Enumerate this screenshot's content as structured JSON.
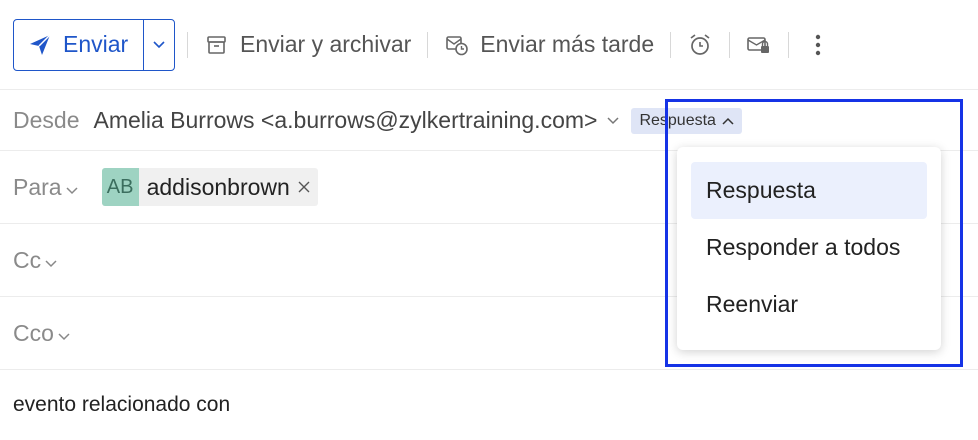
{
  "toolbar": {
    "send_label": "Enviar",
    "send_archive_label": "Enviar y archivar",
    "send_later_label": "Enviar más tarde",
    "icons": [
      "paper-plane-icon",
      "chevron-down-icon",
      "archive-send-icon",
      "schedule-send-icon",
      "alarm-clock-icon",
      "secure-mail-icon",
      "more-vertical-icon"
    ]
  },
  "from": {
    "label": "Desde",
    "value": "Amelia Burrows <a.burrows@zylkertraining.com>",
    "reply_badge": "Respuesta"
  },
  "to": {
    "label": "Para",
    "recipient": {
      "initials": "AB",
      "name": "addisonbrown"
    }
  },
  "cc": {
    "label": "Cc"
  },
  "bcc": {
    "label": "Cco"
  },
  "body": {
    "text": "evento relacionado con"
  },
  "reply_menu": {
    "items": [
      "Respuesta",
      "Responder a todos",
      "Reenviar"
    ],
    "selected": "Respuesta"
  },
  "colors": {
    "accent": "#1f56c9",
    "highlight_border": "#1533e6",
    "badge_bg": "#dfe5f6",
    "avatar_bg": "#9ed3c2",
    "menu_active_bg": "#ebf0fd"
  }
}
